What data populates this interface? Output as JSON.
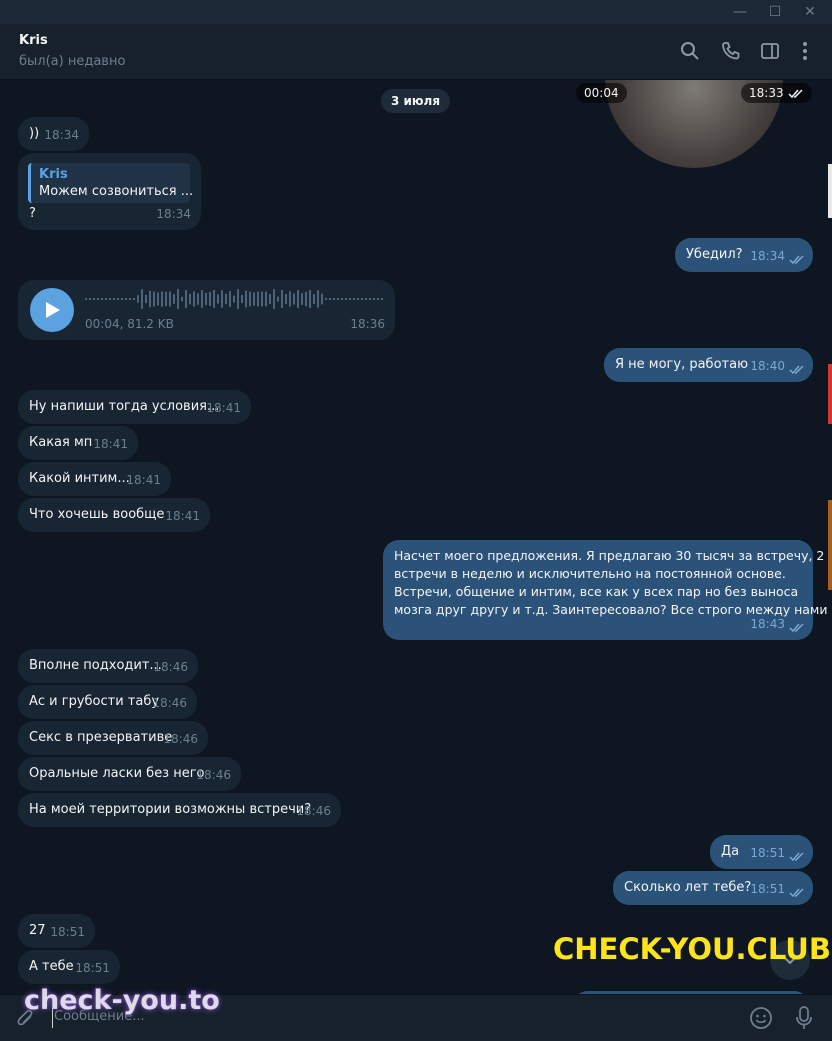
{
  "window": {
    "minimize": "—",
    "maximize": "☐",
    "close": "✕"
  },
  "header": {
    "name": "Kris",
    "status": "был(а) недавно"
  },
  "chat": {
    "date_separator": "3 июля",
    "top_image": {
      "duration": "00:04",
      "time": "18:33"
    },
    "messages": [
      {
        "dir": "in",
        "text": "))",
        "time": "18:34"
      },
      {
        "dir": "in",
        "reply_name": "Kris",
        "reply_text": "Можем созвониться ...",
        "text": "?",
        "time": "18:34"
      },
      {
        "dir": "out",
        "text": "Убедил?",
        "time": "18:34"
      },
      {
        "dir": "in",
        "voice_meta": "00:04, 81.2 KB",
        "time": "18:36"
      },
      {
        "dir": "out",
        "text": "Я не могу, работаю",
        "time": "18:40"
      },
      {
        "dir": "in",
        "text": "Ну напиши тогда условия...",
        "time": "18:41"
      },
      {
        "dir": "in",
        "text": "Какая мп",
        "time": "18:41"
      },
      {
        "dir": "in",
        "text": "Какой интим...",
        "time": "18:41"
      },
      {
        "dir": "in",
        "text": "Что хочешь вообще",
        "time": "18:41"
      },
      {
        "dir": "out",
        "lines": [
          "Насчет моего предложения. Я предлагаю 30 тысяч за встречу, 2",
          "встречи в неделю и исключительно на постоянной основе.",
          "Встречи, общение и интим, все как у всех пар но без выноса",
          "мозга друг другу и т.д. Заинтересовало? Все строго между нами"
        ],
        "time": "18:43"
      },
      {
        "dir": "in",
        "text": "Вполне подходит...",
        "time": "18:46"
      },
      {
        "dir": "in",
        "text": "Ас и грубости табу",
        "time": "18:46"
      },
      {
        "dir": "in",
        "text": "Секс в презервативе",
        "time": "18:46"
      },
      {
        "dir": "in",
        "text": "Оральные ласки без него",
        "time": "18:46"
      },
      {
        "dir": "in",
        "text": "На моей территории возможны встречи?",
        "time": "18:46"
      },
      {
        "dir": "out",
        "text": "Да",
        "time": "18:51"
      },
      {
        "dir": "out",
        "text": "Сколько лет тебе?",
        "time": "18:51"
      },
      {
        "dir": "in",
        "text": "27",
        "time": "18:51"
      },
      {
        "dir": "in",
        "text": "А тебе",
        "time": "18:51"
      }
    ]
  },
  "overlay": {
    "promo_text": "CHECK-YOU.CLUB",
    "watermark": "check-you.to"
  },
  "composer": {
    "placeholder": "Сообщение..."
  },
  "colors": {
    "bg": "#0e1621",
    "in_bubble": "#182533",
    "out_bubble": "#2b5278",
    "accent": "#5aa3e0",
    "promo": "#ffe41a"
  }
}
